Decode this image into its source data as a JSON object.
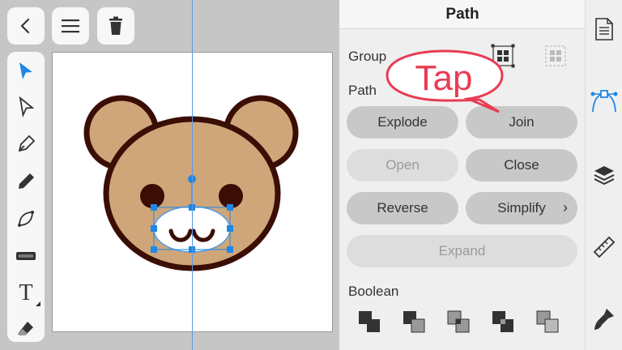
{
  "toolbar_top": {
    "back_icon": "chevron-left-icon",
    "menu_icon": "hamburger-icon",
    "delete_icon": "trash-icon"
  },
  "tools": [
    "select-arrow-icon",
    "direct-select-icon",
    "pen-icon",
    "pencil-icon",
    "shape-icon",
    "brush-icon",
    "text-icon",
    "eraser-icon"
  ],
  "text_tool_glyph": "T",
  "panel": {
    "title": "Path",
    "group_label": "Group",
    "path_label": "Path",
    "buttons": {
      "explode": "Explode",
      "join": "Join",
      "open": "Open",
      "close": "Close",
      "reverse": "Reverse",
      "simplify": "Simplify",
      "expand": "Expand"
    },
    "simplify_chevron": "›",
    "boolean_label": "Boolean"
  },
  "callout_text": "Tap",
  "colors": {
    "accent": "#1e88e5",
    "callout": "#e83c54",
    "bear_fill": "#cfa679",
    "bear_outline": "#3a0e05"
  },
  "sidebar_icons": [
    "document-icon",
    "path-edit-icon",
    "layers-icon",
    "ruler-icon",
    "paint-brush-icon"
  ]
}
